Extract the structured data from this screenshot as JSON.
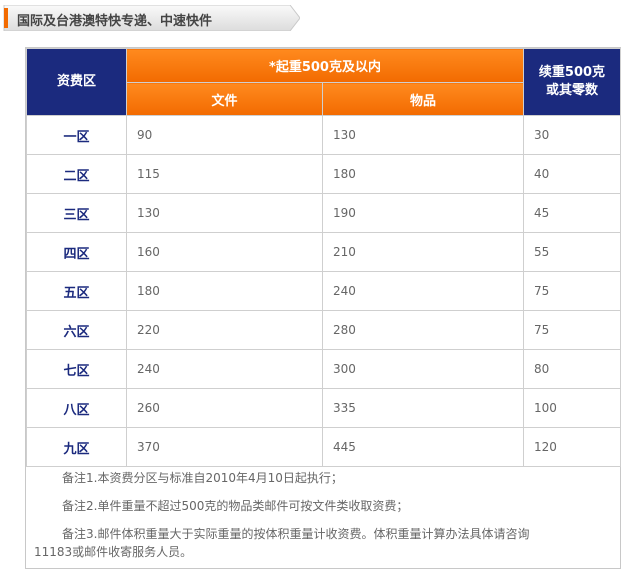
{
  "header": {
    "title": "国际及台港澳特快专递、中速快件"
  },
  "colors": {
    "navy": "#1b2a7e",
    "orange": "#f26a00"
  },
  "table": {
    "zone_header": "资费区",
    "first_weight_header": "*起重500克及以内",
    "document_header": "文件",
    "goods_header": "物品",
    "additional_header_line1": "续重500克",
    "additional_header_line2": "或其零数",
    "rows": [
      {
        "zone": "一区",
        "document": "90",
        "goods": "130",
        "additional": "30"
      },
      {
        "zone": "二区",
        "document": "115",
        "goods": "180",
        "additional": "40"
      },
      {
        "zone": "三区",
        "document": "130",
        "goods": "190",
        "additional": "45"
      },
      {
        "zone": "四区",
        "document": "160",
        "goods": "210",
        "additional": "55"
      },
      {
        "zone": "五区",
        "document": "180",
        "goods": "240",
        "additional": "75"
      },
      {
        "zone": "六区",
        "document": "220",
        "goods": "280",
        "additional": "75"
      },
      {
        "zone": "七区",
        "document": "240",
        "goods": "300",
        "additional": "80"
      },
      {
        "zone": "八区",
        "document": "260",
        "goods": "335",
        "additional": "100"
      },
      {
        "zone": "九区",
        "document": "370",
        "goods": "445",
        "additional": "120"
      }
    ]
  },
  "notes": [
    "备注1.本资费分区与标准自2010年4月10日起执行；",
    "备注2.单件重量不超过500克的物品类邮件可按文件类收取资费；",
    "备注3.邮件体积重量大于实际重量的按体积重量计收资费。体积重量计算办法具体请咨询11183或邮件收寄服务人员。"
  ]
}
